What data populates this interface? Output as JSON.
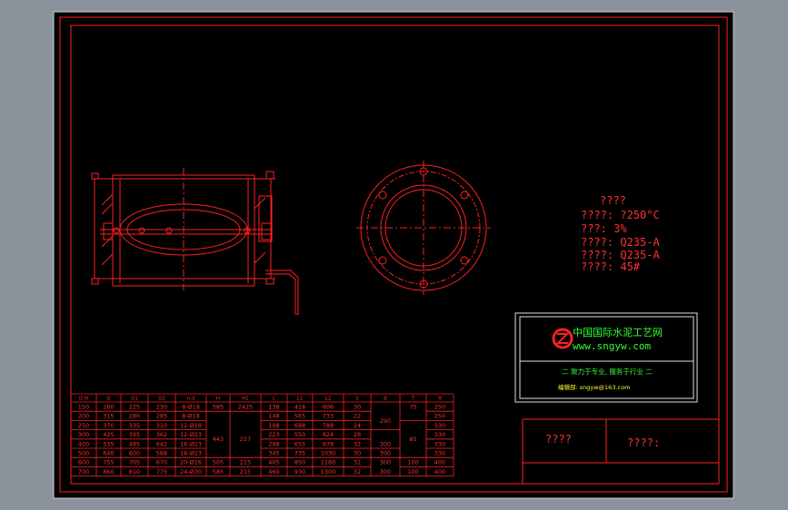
{
  "notes": {
    "heading": "????",
    "lines": [
      "????: ?250°C",
      "???: 3%",
      "????: Q235-A",
      "????: Q235-A",
      "????: 45#"
    ]
  },
  "logo_box": {
    "site_name_cn": "中国国际水泥工艺网",
    "site_url": "www.sngyw.com",
    "slogan": "二 致力于专业, 服务于行业 二",
    "email_line": "编辑部: sngyw@163.com"
  },
  "title_block": {
    "left_cell": "????",
    "right_cell": "????:"
  },
  "table": {
    "headers": [
      "D N",
      "D",
      "D1",
      "D2",
      "n-d",
      "H",
      "H1",
      "L",
      "L1",
      "L2",
      "S",
      "B",
      "T",
      "R"
    ],
    "rows": [
      [
        "150",
        "260",
        "225",
        "230",
        "8-Ø18",
        "",
        "",
        "138",
        "418",
        "606",
        "30",
        "",
        "",
        "250"
      ],
      [
        "200",
        "315",
        "280",
        "285",
        "8-Ø18",
        "",
        "",
        "148",
        "565",
        "733",
        "22",
        "",
        "",
        "250"
      ],
      [
        "250",
        "370",
        "335",
        "310",
        "12-Ø18",
        "",
        "",
        "198",
        "688",
        "788",
        "24",
        "",
        "",
        "330"
      ],
      [
        "300",
        "425",
        "395",
        "362",
        "12-Ø23",
        "",
        "",
        "223",
        "550",
        "824",
        "28",
        "",
        "",
        "330"
      ],
      [
        "400",
        "535",
        "495",
        "642",
        "16-Ø23",
        "",
        "",
        "298",
        "655",
        "978",
        "32",
        "",
        "",
        "330"
      ],
      [
        "500",
        "640",
        "600",
        "588",
        "16-Ø23",
        "",
        "",
        "345",
        "735",
        "1030",
        "30",
        "",
        "",
        "330"
      ],
      [
        "600",
        "755",
        "705",
        "670",
        "20-Ø26",
        "",
        "",
        "405",
        "850",
        "1180",
        "32",
        "",
        "",
        "400"
      ],
      [
        "700",
        "860",
        "810",
        "775",
        "24-Ø30",
        "",
        "",
        "460",
        "930",
        "1300",
        "32",
        "",
        "",
        "400"
      ]
    ],
    "merged": {
      "h_1": "585",
      "h1_1": "2425",
      "h_mid": "443",
      "h1_mid": "227",
      "h_last": "505",
      "h1_last": "215",
      "h_last2": "585",
      "h1_last2": "215",
      "b_top": "290",
      "b_mid": "300",
      "b_bot1": "300",
      "b_bot2": "300",
      "b_bot3": "300",
      "t_top": "75",
      "t_mid": "85",
      "t_bot1": "100",
      "t_bot2": "100"
    }
  }
}
